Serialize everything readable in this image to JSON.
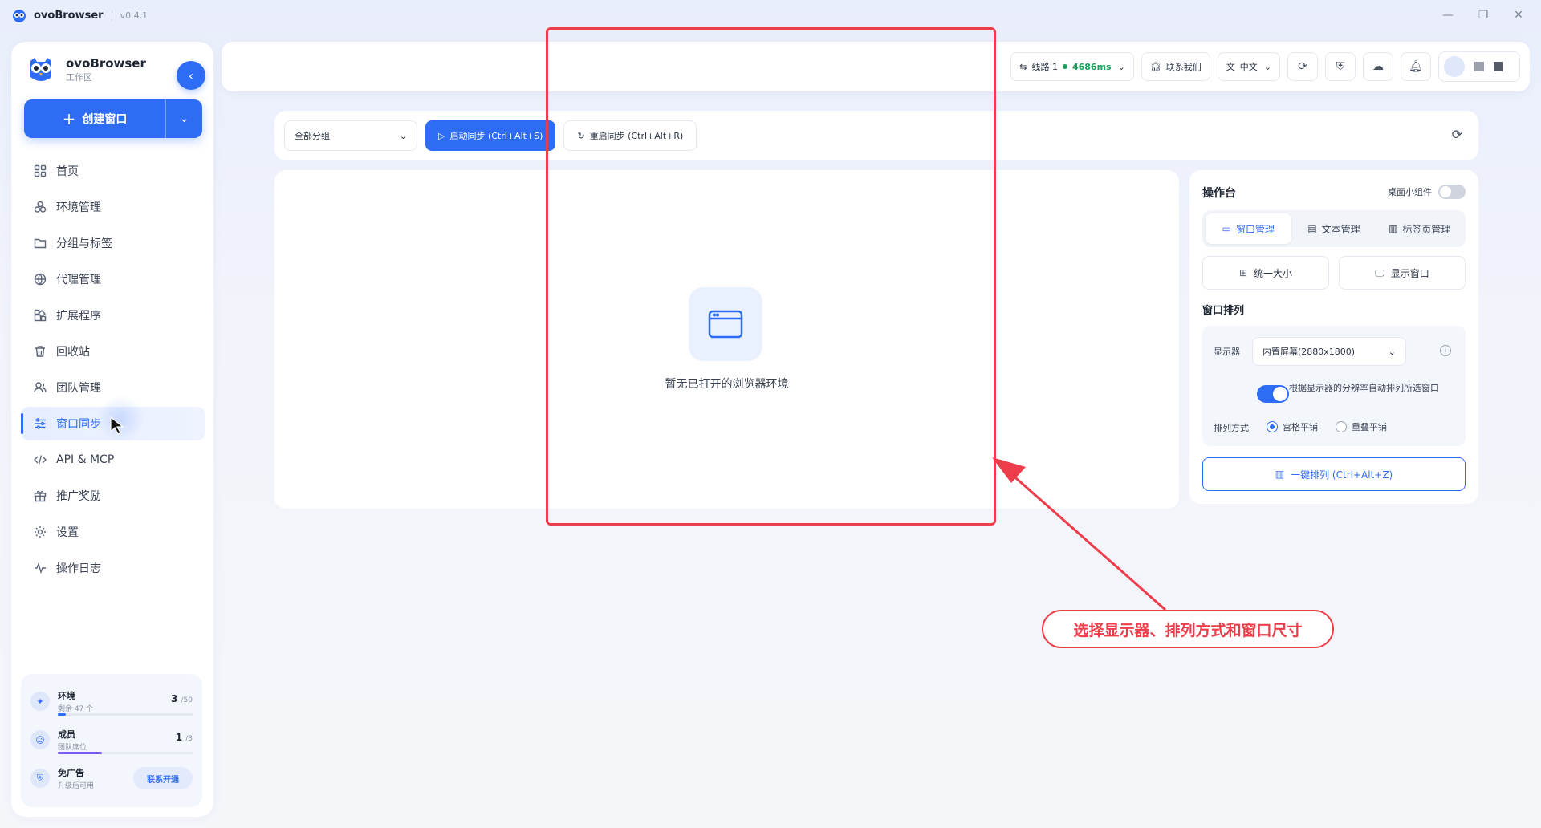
{
  "titlebar": {
    "app_name": "ovoBrowser",
    "version": "v0.4.1"
  },
  "sidebar": {
    "brand_name": "ovoBrowser",
    "brand_sub": "工作区",
    "create_label": "创建窗口",
    "items": [
      {
        "label": "首页",
        "icon": "grid-icon"
      },
      {
        "label": "环境管理",
        "icon": "cubes-icon"
      },
      {
        "label": "分组与标签",
        "icon": "folder-icon"
      },
      {
        "label": "代理管理",
        "icon": "globe-icon"
      },
      {
        "label": "扩展程序",
        "icon": "puzzle-icon"
      },
      {
        "label": "回收站",
        "icon": "trash-icon"
      },
      {
        "label": "团队管理",
        "icon": "users-icon"
      },
      {
        "label": "窗口同步",
        "icon": "sliders-icon",
        "active": true
      },
      {
        "label": "API & MCP",
        "icon": "code-icon"
      },
      {
        "label": "推广奖励",
        "icon": "gift-icon"
      },
      {
        "label": "设置",
        "icon": "gear-icon"
      },
      {
        "label": "操作日志",
        "icon": "pulse-icon"
      }
    ],
    "quota": {
      "env": {
        "title": "环境",
        "sub": "剩余 47 个",
        "used": "3",
        "total": "/50",
        "fraction": 0.06
      },
      "members": {
        "title": "成员",
        "sub": "团队席位",
        "used": "1",
        "total": "/3",
        "fraction": 0.33
      },
      "ad": {
        "title": "免广告",
        "sub": "升级后可用",
        "button": "联系开通"
      }
    }
  },
  "header": {
    "line_label": "线路 1",
    "latency": "4686ms",
    "contact": "联系我们",
    "language": "中文"
  },
  "toolbar": {
    "group_select": "全部分组",
    "start_sync": "启动同步 (Ctrl+Alt+S)",
    "restart_sync": "重启同步 (Ctrl+Alt+R)"
  },
  "main": {
    "empty_text": "暂无已打开的浏览器环境"
  },
  "console": {
    "title": "操作台",
    "widget_label": "桌面小组件",
    "tabs": [
      {
        "label": "窗口管理",
        "active": true
      },
      {
        "label": "文本管理"
      },
      {
        "label": "标签页管理"
      }
    ],
    "btn_uniform": "统一大小",
    "btn_show": "显示窗口",
    "arrange_title": "窗口排列",
    "display_label": "显示器",
    "display_value": "内置屏幕(2880x1800)",
    "auto_text": "根据显示器的分辨率自动排列所选窗口",
    "arrange_mode_label": "排列方式",
    "mode_grid": "宫格平铺",
    "mode_overlap": "重叠平铺",
    "onekey": "一键排列 (Ctrl+Alt+Z)"
  },
  "annotation": {
    "callout": "选择显示器、排列方式和窗口尺寸"
  },
  "colors": {
    "accent": "#2f6cf6",
    "annotation": "#ee3d4a",
    "success": "#19a05a"
  }
}
